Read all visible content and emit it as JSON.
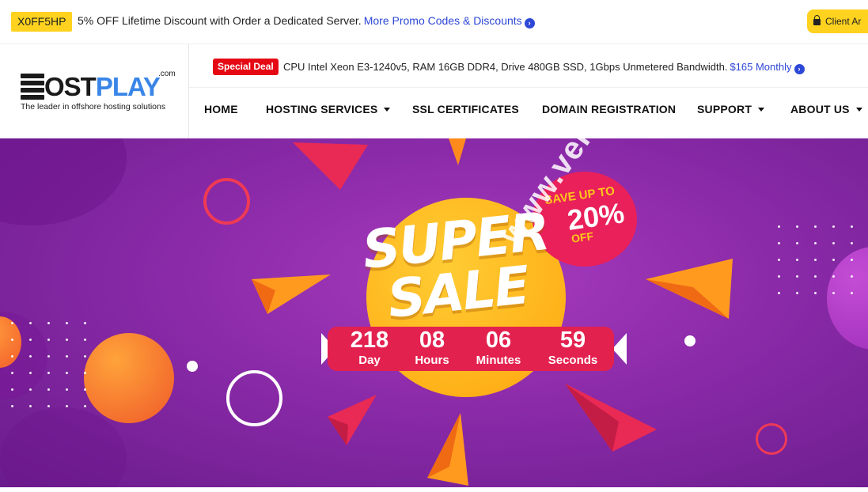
{
  "promo": {
    "code": "X0FF5HP",
    "text": "5% OFF Lifetime Discount with Order a Dedicated Server.",
    "link": "More Promo Codes & Discounts"
  },
  "client_area": {
    "label": "Client Ar"
  },
  "logo": {
    "word_dark": "OST",
    "word_light": "PLAY",
    "com": ".com",
    "tagline": "The leader in offshore hosting solutions"
  },
  "special_deal": {
    "badge": "Special Deal",
    "text": "CPU Intel Xeon E3-1240v5, RAM 16GB DDR4, Drive 480GB SSD, 1Gbps Unmetered Bandwidth.",
    "price": "$165 Monthly"
  },
  "nav": {
    "items": [
      {
        "label": "HOME",
        "has_caret": false
      },
      {
        "label": "HOSTING SERVICES",
        "has_caret": true
      },
      {
        "label": "SSL CERTIFICATES",
        "has_caret": false
      },
      {
        "label": "DOMAIN REGISTRATION",
        "has_caret": false
      },
      {
        "label": "SUPPORT",
        "has_caret": true
      },
      {
        "label": "ABOUT US",
        "has_caret": true
      }
    ]
  },
  "hero": {
    "line1": "SUPER",
    "line2": "SALE",
    "badge_save": "SAVE UP TO",
    "badge_percent": "20%",
    "badge_off": "OFF",
    "countdown": [
      {
        "value": "218",
        "label": "Day"
      },
      {
        "value": "08",
        "label": "Hours"
      },
      {
        "value": "06",
        "label": "Minutes"
      },
      {
        "value": "59",
        "label": "Seconds"
      }
    ],
    "watermark": "www.veidc"
  },
  "colors": {
    "accent_yellow": "#ffd21f",
    "link_blue": "#2d47d6",
    "deal_red": "#e50914",
    "hero_purple": "#8a2aa8",
    "counter_red": "#e3214f",
    "sun_orange": "#ffb21a"
  },
  "icons": {
    "promo_link_arrow": "arrow-circle-right-icon",
    "client_lock": "lock-icon",
    "deal_arrow": "arrow-circle-right-icon",
    "nav_caret": "caret-down-icon"
  }
}
